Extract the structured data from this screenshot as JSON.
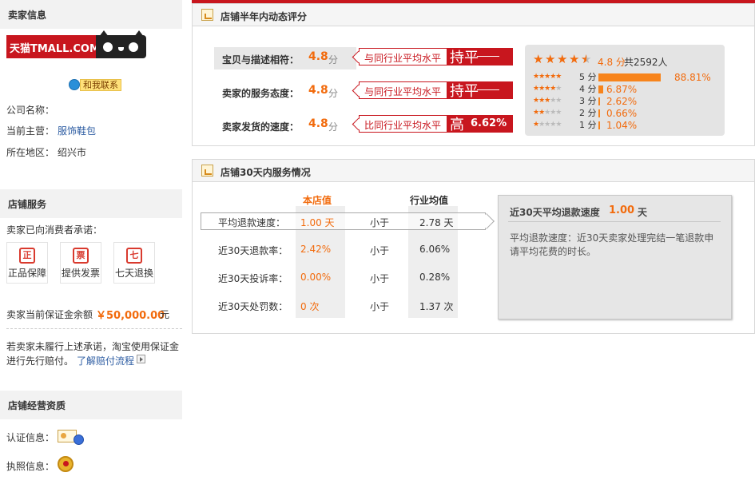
{
  "seller": {
    "header": "卖家信息",
    "logo_text": "天猫TMALL.COM",
    "contact_label": "和我联系",
    "company_label": "公司名称：",
    "category_label": "当前主营：",
    "category_value": "服饰鞋包",
    "region_label": "所在地区：",
    "region_value": "绍兴市"
  },
  "store_service": {
    "header": "店铺服务",
    "promise_label": "卖家已向消费者承诺：",
    "badges": [
      {
        "icon": "authentic-icon",
        "glyph": "正",
        "label": "正品保障"
      },
      {
        "icon": "invoice-icon",
        "glyph": "票",
        "label": "提供发票"
      },
      {
        "icon": "seven-day-return-icon",
        "glyph": "七",
        "label": "七天退换"
      }
    ],
    "deposit_label": "卖家当前保证金余额",
    "deposit_value": "￥50,000.00",
    "deposit_unit": "元",
    "note_line1": "若卖家未履行上述承诺，淘宝使用保证金",
    "note_line2": "进行先行赔付。",
    "note_link": "了解赔付流程"
  },
  "qualification": {
    "header": "店铺经营资质",
    "cert_label": "认证信息：",
    "license_label": "执照信息："
  },
  "dynamic_rating": {
    "title": "店铺半年内动态评分",
    "rows": [
      {
        "label": "宝贝与描述相符：",
        "score": "4.8",
        "unit": "分",
        "compare_label": "与同行业平均水平",
        "compare_word": "持平",
        "compare_pct": ""
      },
      {
        "label": "卖家的服务态度：",
        "score": "4.8",
        "unit": "分",
        "compare_label": "与同行业平均水平",
        "compare_word": "持平",
        "compare_pct": ""
      },
      {
        "label": "卖家发货的速度：",
        "score": "4.8",
        "unit": "分",
        "compare_label": "比同行业平均水平",
        "compare_word": "高",
        "compare_pct": "6.62%"
      }
    ],
    "summary_score": "4.8 分",
    "summary_count": "共2592人",
    "stars_filled": 4.5,
    "distribution": [
      {
        "label": "5 分",
        "stars": 5,
        "percent": "88.81%",
        "value": 88.81
      },
      {
        "label": "4 分",
        "stars": 4,
        "percent": "6.87%",
        "value": 6.87
      },
      {
        "label": "3 分",
        "stars": 3,
        "percent": "2.62%",
        "value": 2.62
      },
      {
        "label": "2 分",
        "stars": 2,
        "percent": "0.66%",
        "value": 0.66
      },
      {
        "label": "1 分",
        "stars": 1,
        "percent": "1.04%",
        "value": 1.04
      }
    ]
  },
  "service_30": {
    "title": "店铺30天内服务情况",
    "col_store": "本店值",
    "col_industry": "行业均值",
    "rows": [
      {
        "label": "平均退款速度：",
        "store": "1.00 天",
        "cmp": "小于",
        "industry": "2.78 天"
      },
      {
        "label": "近30天退款率：",
        "store": "2.42%",
        "cmp": "小于",
        "industry": "6.06%"
      },
      {
        "label": "近30天投诉率：",
        "store": "0.00%",
        "cmp": "小于",
        "industry": "0.28%"
      },
      {
        "label": "近30天处罚数：",
        "store": "0 次",
        "cmp": "小于",
        "industry": "1.37 次"
      }
    ],
    "tip": {
      "title": "近30天平均退款速度",
      "value": "1.00",
      "unit": "天",
      "body": "平均退款速度：近30天卖家处理完结一笔退款申请平均花费的时长。"
    }
  },
  "colors": {
    "accent": "#f26b0d",
    "tmall_red": "#c8161e",
    "link": "#2f5ea3"
  }
}
